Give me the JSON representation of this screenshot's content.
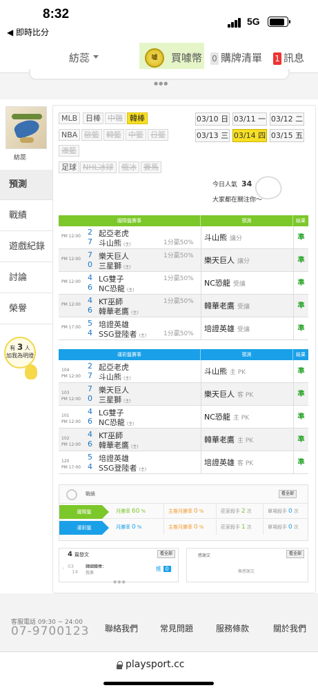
{
  "status": {
    "time": "8:32",
    "back": "◀ 即時比分",
    "network": "5G"
  },
  "topnav": {
    "user": "紡蕊",
    "buy": "買噱幣",
    "list_count": "0",
    "list": "購牌清單",
    "msg_count": "1",
    "msg": "訊息",
    "coin_icon": "coin-icon"
  },
  "profile": {
    "name": "紡蕊"
  },
  "side": [
    "預測",
    "戰績",
    "遊戲紀錄",
    "討論",
    "榮譽"
  ],
  "popular_side": {
    "pre": "有",
    "num": "3",
    "unit": "人",
    "post": "加我為明燈"
  },
  "leagues": {
    "r1": [
      "MLB",
      "日棒",
      "中職",
      "韓棒"
    ],
    "r2": [
      "NBA",
      "歐籃",
      "韓籃",
      "中籃",
      "日籃",
      "澳籃"
    ],
    "r3": [
      "足球",
      "NHL冰球",
      "俄冰",
      "賽馬"
    ]
  },
  "dates": [
    [
      "03/10",
      "日"
    ],
    [
      "03/11",
      "一"
    ],
    [
      "03/12",
      "二"
    ],
    [
      "03/13",
      "三"
    ],
    [
      "03/14",
      "四"
    ],
    [
      "03/15",
      "五"
    ]
  ],
  "popularity": {
    "label": "今日人氣",
    "value": "34",
    "note": "大家都在關注你～"
  },
  "intl": {
    "h1": "國際盤賽事",
    "h2": "預測",
    "h3": "結果"
  },
  "lottery": {
    "h1": "運彩盤賽事",
    "h2": "預測",
    "h3": "結果"
  },
  "games": [
    {
      "time": "PM 12:00",
      "s1": "2",
      "t1": "起亞老虎",
      "s2": "7",
      "t2": "斗山熊",
      "h": "",
      "hb": "1分贏50%",
      "pick": "斗山熊",
      "pk": "讓分",
      "lno": "104",
      "lpick": "斗山熊",
      "lpk": "主 PK",
      "res": "準"
    },
    {
      "time": "PM 12:00",
      "s1": "7",
      "t1": "樂天巨人",
      "s2": "0",
      "t2": "三星獅",
      "h": "1分贏50%",
      "hb": "",
      "pick": "樂天巨人",
      "pk": "讓分",
      "lno": "103",
      "lpick": "樂天巨人",
      "lpk": "客 PK",
      "res": "準"
    },
    {
      "time": "PM 12:00",
      "s1": "4",
      "t1": "LG雙子",
      "s2": "6",
      "t2": "NC恐龍",
      "h": "1分贏50%",
      "hb": "",
      "pick": "NC恐龍",
      "pk": "受讓",
      "lno": "101",
      "lpick": "NC恐龍",
      "lpk": "主 PK",
      "res": "準"
    },
    {
      "time": "PM 12:00",
      "s1": "4",
      "t1": "KT巫師",
      "s2": "6",
      "t2": "韓華老鷹",
      "h": "1分贏50%",
      "hb": "",
      "pick": "韓華老鷹",
      "pk": "受讓",
      "lno": "102",
      "lpick": "韓華老鷹",
      "lpk": "主 PK",
      "res": "準"
    },
    {
      "time": "PM 17:00",
      "s1": "5",
      "t1": "培證英雄",
      "s2": "4",
      "t2": "SSG登陸者",
      "h": "",
      "hb": "1分贏50%",
      "pick": "培證英雄",
      "pk": "受讓",
      "lno": "120",
      "lpick": "培證英雄",
      "lpk": "客 PK",
      "res": "準"
    }
  ],
  "perf": {
    "title": "戰績",
    "see": "看全部",
    "rows": [
      {
        "badge": "國際盤",
        "c1": "月勝率",
        "v1": "60",
        "u1": "%",
        "c2": "主推月勝率",
        "v2": "0",
        "u2": "%",
        "c3": "莊家殺手",
        "v3": "2",
        "u3": "次",
        "c4": "單場殺手",
        "v4": "0",
        "u4": "次"
      },
      {
        "badge": "運彩盤",
        "c1": "月勝率",
        "v1": "0",
        "u1": "%",
        "c2": "主推月勝率",
        "v2": "0",
        "u2": "%",
        "c3": "莊家殺手",
        "v3": "1",
        "u3": "次",
        "c4": "單場殺手",
        "v4": "0",
        "u4": "次"
      }
    ]
  },
  "article": {
    "count": "4",
    "label": "篇發文",
    "see": "看全部",
    "day": "03",
    "mon": "14",
    "title": "韓國職棒：",
    "sub": "我來",
    "tag": "推",
    "num": "0"
  },
  "thanks": {
    "label": "感謝文",
    "see": "看全部",
    "empty": "無感謝文"
  },
  "footer": {
    "phone_label": "客服電話 09:30 ~ 24:00",
    "phone": "07-9700123",
    "links": [
      "聯絡我們",
      "常見問題",
      "服務條款",
      "關於我們"
    ]
  },
  "url": "playsport.cc",
  "colors": {
    "green": "#7cc72a",
    "blue": "#1aa0e8",
    "yellow": "#f7df24",
    "win": "#2ba52a"
  }
}
